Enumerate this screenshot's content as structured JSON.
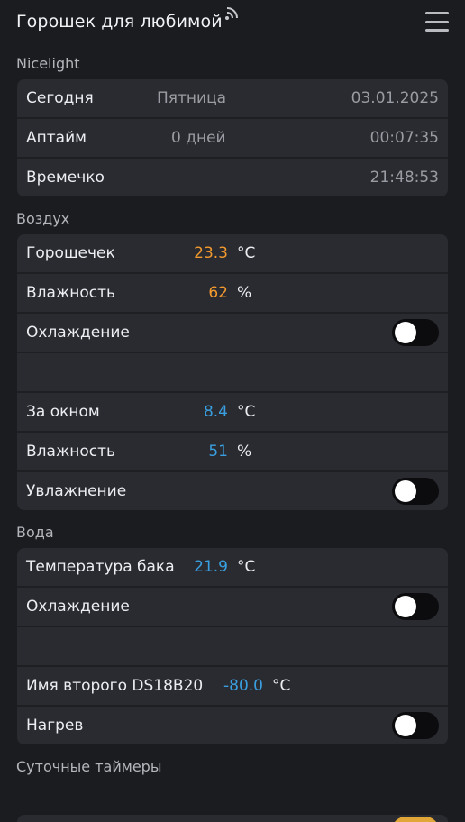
{
  "header": {
    "title": "Горошек для любимой"
  },
  "sections": {
    "nicelight": {
      "title": "Nicelight",
      "today_label": "Сегодня",
      "today_day": "Пятница",
      "today_date": "03.01.2025",
      "uptime_label": "Аптайм",
      "uptime_days": "0 дней",
      "uptime_time": "00:07:35",
      "time_label": "Времечко",
      "time_value": "21:48:53"
    },
    "air": {
      "title": "Воздух",
      "inside_label": "Горошечек",
      "inside_temp": "23.3",
      "inside_temp_unit": "°C",
      "inside_hum_label": "Влажность",
      "inside_hum": "62",
      "inside_hum_unit": "%",
      "cooling_label": "Охлаждение",
      "outside_label": "За окном",
      "outside_temp": "8.4",
      "outside_temp_unit": "°C",
      "outside_hum_label": "Влажность",
      "outside_hum": "51",
      "outside_hum_unit": "%",
      "humidify_label": "Увлажнение"
    },
    "water": {
      "title": "Вода",
      "tank_label": "Температура бака",
      "tank_temp": "21.9",
      "tank_temp_unit": "°C",
      "cooling_label": "Охлаждение",
      "second_label": "Имя второго DS18B20",
      "second_temp": "-80.0",
      "second_temp_unit": "°C",
      "heating_label": "Нагрев"
    },
    "timers": {
      "title": "Суточные таймеры"
    }
  },
  "toggles": {
    "air_cooling": false,
    "air_humidify": false,
    "water_cooling": false,
    "water_heating": false
  },
  "colors": {
    "background": "#1b1c20",
    "card": "#2a2b31",
    "accent_orange": "#f39a2e",
    "accent_blue": "#3a9fe0",
    "toggle_on": "#e0a637"
  },
  "icons": [
    "wifi-icon",
    "menu-icon"
  ]
}
